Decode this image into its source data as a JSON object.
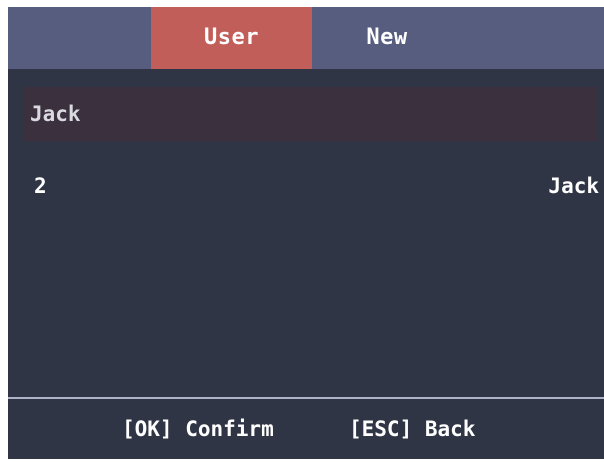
{
  "tabs": [
    {
      "label": "User",
      "active": true
    },
    {
      "label": "New",
      "active": false
    }
  ],
  "search": {
    "value": "Jack"
  },
  "results": [
    {
      "id": "2",
      "name": "Jack"
    }
  ],
  "footer": {
    "confirm_label": "[OK] Confirm",
    "back_label": "[ESC] Back"
  },
  "colors": {
    "background": "#2f3544",
    "tabbar": "#565d7e",
    "active_tab": "#c25e59",
    "search_bar": "#3a303e",
    "divider": "#aeb4c7",
    "text": "#ffffff"
  }
}
